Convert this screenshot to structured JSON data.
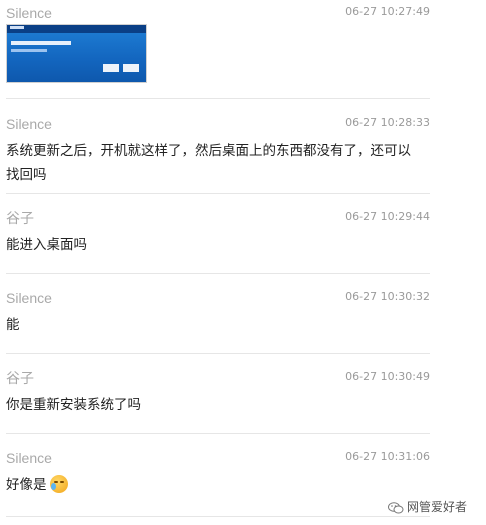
{
  "messages": [
    {
      "sender": "Silence",
      "time": "06-27 10:27:49",
      "type": "image"
    },
    {
      "sender": "Silence",
      "time": "06-27 10:28:33",
      "text": "系统更新之后，开机就这样了，然后桌面上的东西都没有了，还可以找回吗"
    },
    {
      "sender": "谷子",
      "time": "06-27 10:29:44",
      "text": "能进入桌面吗"
    },
    {
      "sender": "Silence",
      "time": "06-27 10:30:32",
      "text": "能"
    },
    {
      "sender": "谷子",
      "time": "06-27 10:30:49",
      "text": "你是重新安装系统了吗"
    },
    {
      "sender": "Silence",
      "time": "06-27 10:31:06",
      "text": "好像是",
      "emoji": "crying-laughing-icon"
    }
  ],
  "watermark": "网管爱好者",
  "colors": {
    "sender": "#a9a9a9",
    "time": "#9a9a9a",
    "text": "#222222",
    "divider": "#e6e6e6",
    "thumb": "#1366bf"
  }
}
